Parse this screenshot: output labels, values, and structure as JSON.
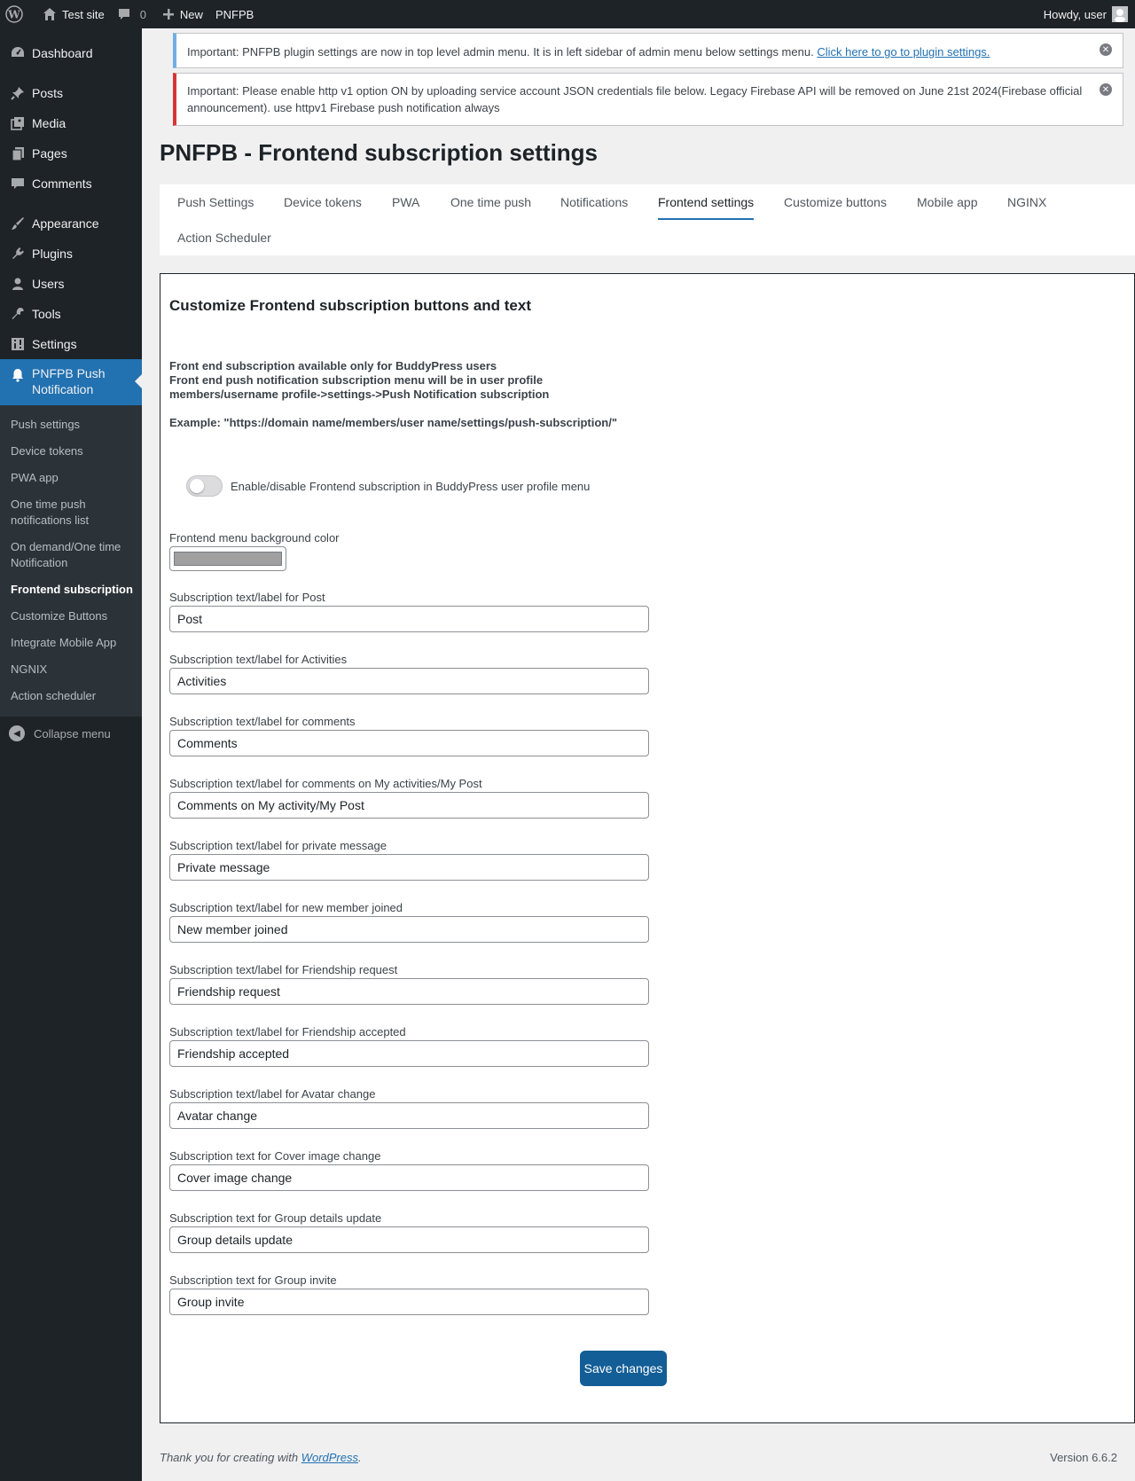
{
  "adminbar": {
    "site_name": "Test site",
    "comments_count": "0",
    "new_label": "New",
    "plugin_label": "PNFPB",
    "howdy": "Howdy, user"
  },
  "sidebar": {
    "items": [
      {
        "label": "Dashboard",
        "icon": "dashboard-icon"
      },
      {
        "label": "Posts",
        "icon": "pin-icon"
      },
      {
        "label": "Media",
        "icon": "media-icon"
      },
      {
        "label": "Pages",
        "icon": "pages-icon"
      },
      {
        "label": "Comments",
        "icon": "comment-icon"
      },
      {
        "label": "Appearance",
        "icon": "brush-icon"
      },
      {
        "label": "Plugins",
        "icon": "plug-icon"
      },
      {
        "label": "Users",
        "icon": "user-icon"
      },
      {
        "label": "Tools",
        "icon": "wrench-icon"
      },
      {
        "label": "Settings",
        "icon": "settings-icon"
      }
    ],
    "current": {
      "label_line1": "PNFPB Push",
      "label_line2": "Notification",
      "icon": "bell-icon"
    },
    "submenu": [
      "Push settings",
      "Device tokens",
      "PWA app",
      "One time push notifications list",
      "On demand/One time Notification",
      "Frontend subscription",
      "Customize Buttons",
      "Integrate Mobile App",
      "NGNIX",
      "Action scheduler"
    ],
    "collapse_label": "Collapse menu"
  },
  "notices": {
    "info_text": "Important: PNFPB plugin settings are now in top level admin menu. It is in left sidebar of admin menu below settings menu. ",
    "info_link": "Click here to go to plugin settings.",
    "error_text": "Important: Please enable http v1 option ON by uploading service account JSON credentials file below. Legacy Firebase API will be removed on June 21st 2024(Firebase official announcement). use httpv1 Firebase push notification always"
  },
  "page_title": "PNFPB - Frontend subscription settings",
  "tabs": [
    "Push Settings",
    "Device tokens",
    "PWA",
    "One time push",
    "Notifications",
    "Frontend settings",
    "Customize buttons",
    "Mobile app",
    "NGINX",
    "Action Scheduler"
  ],
  "active_tab": "Frontend settings",
  "panel": {
    "heading": "Customize Frontend subscription buttons and text",
    "desc_line1": "Front end subscription available only for BuddyPress users",
    "desc_line2": "Front end push notification subscription menu will be in user profile",
    "desc_line3": "members/username profile->settings->Push Notification subscription",
    "example": "Example: \"https://domain name/members/user name/settings/push-subscription/\"",
    "toggle_label": "Enable/disable Frontend subscription in BuddyPress user profile menu",
    "toggle_on": false,
    "color_label": "Frontend menu background color",
    "color_value": "#a0a0a0",
    "fields": [
      {
        "label": "Subscription text/label for Post",
        "value": "Post"
      },
      {
        "label": "Subscription text/label for Activities",
        "value": "Activities"
      },
      {
        "label": "Subscription text/label for comments",
        "value": "Comments"
      },
      {
        "label": "Subscription text/label for comments on My activities/My Post",
        "value": "Comments on My activity/My Post"
      },
      {
        "label": "Subscription text/label for private message",
        "value": "Private message"
      },
      {
        "label": "Subscription text/label for new member joined",
        "value": "New member joined"
      },
      {
        "label": "Subscription text/label for Friendship request",
        "value": "Friendship request"
      },
      {
        "label": "Subscription text/label for Friendship accepted",
        "value": "Friendship accepted"
      },
      {
        "label": "Subscription text/label for Avatar change",
        "value": "Avatar change"
      },
      {
        "label": "Subscription text for Cover image change",
        "value": "Cover image change"
      },
      {
        "label": "Subscription text for Group details update",
        "value": "Group details update"
      },
      {
        "label": "Subscription text for Group invite",
        "value": "Group invite"
      }
    ],
    "save_label": "Save changes"
  },
  "footer": {
    "thanks_prefix": "Thank you for creating with ",
    "thanks_link": "WordPress",
    "thanks_suffix": ".",
    "version": "Version 6.6.2"
  }
}
